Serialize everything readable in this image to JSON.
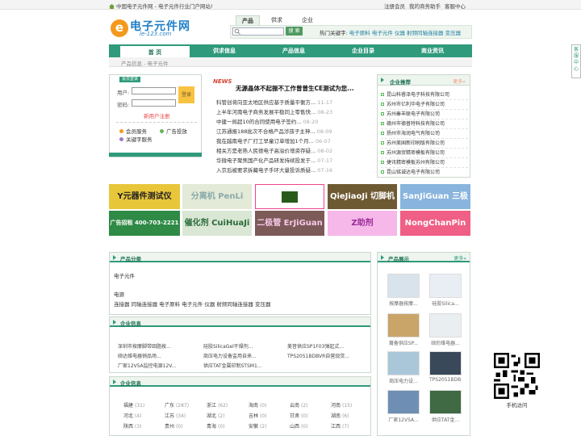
{
  "topbar": {
    "left": "中国电子元件网 - 电子元件行业门户网站!",
    "links": [
      "注册会员",
      "我的商务助手",
      "客服中心"
    ]
  },
  "logo": {
    "mark": "e",
    "title": "电子元件网",
    "url": "le-123.com"
  },
  "search": {
    "tabs": [
      "产品",
      "供求",
      "企业"
    ],
    "button": "搜 索",
    "hot_label": "热门关键字:",
    "hot": [
      "电子原料",
      "电子元件",
      "仪器",
      "射频同轴连接器",
      "变压器"
    ]
  },
  "nav": [
    "首 页",
    "供求信息",
    "产品信息",
    "企业目录",
    "商业资讯"
  ],
  "crumb": "产品信息 - 电子元件",
  "login": {
    "badge": "会员登录",
    "user_label": "用户:",
    "pass_label": "密码:",
    "submit": "登录",
    "register": "新用户注册",
    "links": [
      "会员服务",
      "广告投放",
      "关键字服务"
    ]
  },
  "news": {
    "badge": "NEWS",
    "headline": "无源晶体不起振不工作曾曾生CE测试为您...",
    "items": [
      {
        "t": "科管创将向亚太地区供应基于质量平衡方...",
        "d": "11-17"
      },
      {
        "t": "上半年河南电子商务发展平稳同上零售快...",
        "d": "08-23"
      },
      {
        "t": "中建一局超10的合同使用电子签约...",
        "d": "08-20"
      },
      {
        "t": "江苏通报188批次不合格产品涉孩子主神...",
        "d": "08-09"
      },
      {
        "t": "我在越南电子厂打工早童订单增加1个月...",
        "d": "06-07"
      },
      {
        "t": "相关方是老熟人民德电子高溢价增资存疑...",
        "d": "08-02"
      },
      {
        "t": "华微电子聚焦国产化产品研发持续投发于...",
        "d": "07-17"
      },
      {
        "t": "入京后被要求拆藏电子手环大量投诉质疑...",
        "d": "07-16"
      }
    ]
  },
  "corp": {
    "title": "企业推荐",
    "more": "更多»",
    "items": [
      "昆山科睿泽电子科技有限公司",
      "苏州市亿利华电子有限公司",
      "苏州秦丰联电子有限公司",
      "赣州市德普特科技有限公司",
      "扬州市海润电气有限公司",
      "苏州美国新印刷版有限公司",
      "苏州源贸精密模板有限公司",
      "捷讯精密模板苏州有限公司",
      "昆山铭诚达电子有限公司",
      "江阴市宏豪电子有限公司"
    ]
  },
  "banners_row1": [
    {
      "label": "Y元器件测试仪",
      "bg": "#e8c63a",
      "fg": "#222"
    },
    {
      "label": "分离机 PenLi",
      "bg": "#e4ead8",
      "fg": "#8aa"
    },
    {
      "label": "",
      "bg": "#fff",
      "fg": "#222"
    },
    {
      "label": "QieJiaoJi 切脚机",
      "bg": "#6e5a32",
      "fg": "#fff"
    },
    {
      "label": "SanJiGuan 三极管",
      "bg": "#89b4dd",
      "fg": "#fff"
    }
  ],
  "banners_row2": [
    {
      "label": "广告招租 400-703-2221",
      "bg": "#2f8a45",
      "fg": "#fff"
    },
    {
      "label": "催化剂 CuiHuaJi",
      "bg": "#d9e7d4",
      "fg": "#2f6"
    },
    {
      "label": "二极管 ErJiGuan",
      "bg": "#7c5a58",
      "fg": "#f6c"
    },
    {
      "label": "Z助剂",
      "bg": "#f6b8e8",
      "fg": "#c3c"
    },
    {
      "label": "NongChanPin 农产品",
      "bg": "#ef5f86",
      "fg": "#fff"
    }
  ],
  "cat": {
    "title": "产品分类",
    "name": "电子元件",
    "sub": "电源",
    "items": [
      "连接器",
      "同轴连接器",
      "电子原料",
      "电子元件",
      "仪器",
      "射频同轴连接器",
      "变压器"
    ]
  },
  "cinfo": {
    "title": "企业信息",
    "items": [
      "深圳市按摩脚带田脂按...",
      "硅胶SilicaGel干燥剂...",
      "美音供应SP1F03弹起式...",
      "硕达维电器销品场...",
      "商压电力设备监用自来...",
      "TPS2051BDBVR自营现货...",
      "厂家12V5A监控电源12V...",
      "供应TAT金属印制STSM1..."
    ]
  },
  "prods": {
    "title": "产品展示",
    "more": "更多»",
    "items": [
      "按摩器按摩...",
      "硅胶Silica...",
      "莆备供应SP...",
      "硕珩维电器...",
      "商压电力设...",
      "TPS2051BDB...",
      "厂家12V5A...",
      "供应TAT金..."
    ]
  },
  "regions": {
    "title": "企业信息",
    "items": [
      [
        "福建",
        "(31)"
      ],
      [
        "广东",
        "(287)"
      ],
      [
        "浙江",
        "(62)"
      ],
      [
        "海南",
        "(0)"
      ],
      [
        "云南",
        "(2)"
      ],
      [
        "河南",
        "(15)"
      ],
      [
        "河北",
        "(4)"
      ],
      [
        "江苏",
        "(34)"
      ],
      [
        "湖北",
        "(2)"
      ],
      [
        "吉林",
        "(0)"
      ],
      [
        "甘肃",
        "(0)"
      ],
      [
        "湖南",
        "(6)"
      ],
      [
        "陕西",
        "(3)"
      ],
      [
        "贵州",
        "(0)"
      ],
      [
        "青海",
        "(0)"
      ],
      [
        "安徽",
        "(2)"
      ],
      [
        "山西",
        "(0)"
      ],
      [
        "江西",
        "(7)"
      ]
    ]
  },
  "side": "客服中心",
  "qr": {
    "caption": "手机访问"
  }
}
